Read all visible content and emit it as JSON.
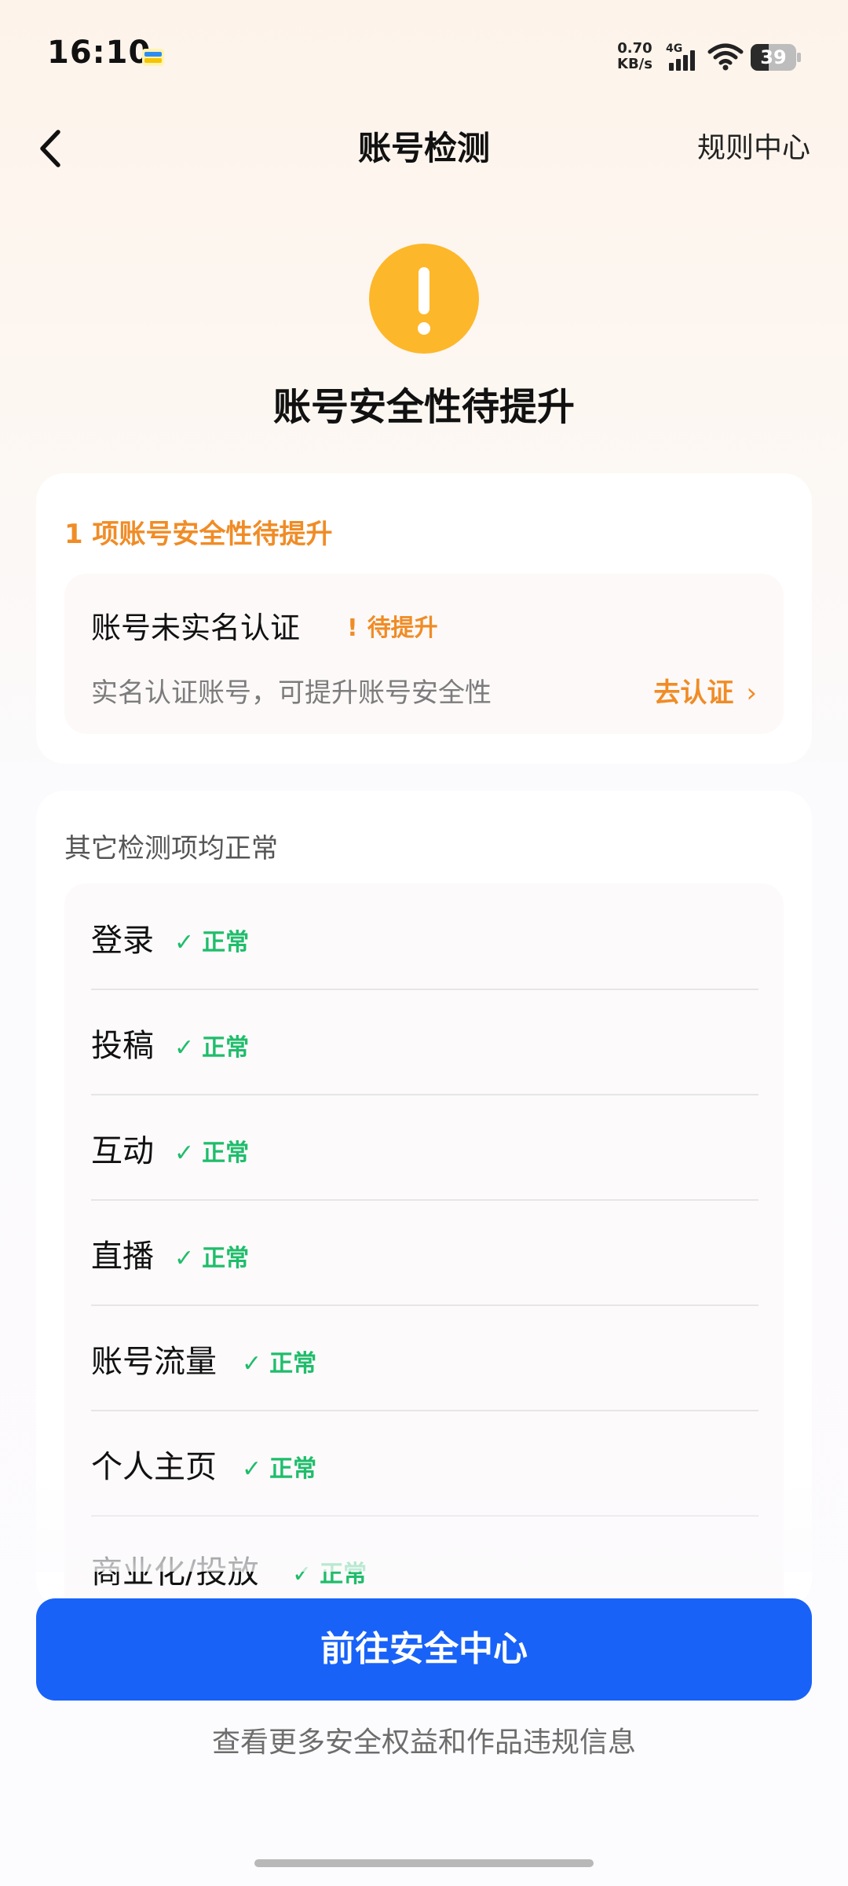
{
  "status_bar": {
    "time": "16:10",
    "net_speed_value": "0.70",
    "net_speed_unit": "KB/s",
    "network_type": "4G",
    "battery_level": "39",
    "battery_fraction": 0.39
  },
  "nav": {
    "title": "账号检测",
    "rules_label": "规则中心"
  },
  "status": {
    "title": "账号安全性待提升",
    "icon": "warning-icon",
    "color": "#fdb72a"
  },
  "issues": {
    "heading": "1 项账号安全性待提升",
    "items": [
      {
        "title": "账号未实名认证",
        "badge": "待提升",
        "description": "实名认证账号，可提升账号安全性",
        "action": "去认证"
      }
    ]
  },
  "checks": {
    "heading": "其它检测项均正常",
    "items": [
      {
        "label": "登录",
        "status": "正常"
      },
      {
        "label": "投稿",
        "status": "正常"
      },
      {
        "label": "互动",
        "status": "正常"
      },
      {
        "label": "直播",
        "status": "正常"
      },
      {
        "label": "账号流量",
        "status": "正常"
      },
      {
        "label": "个人主页",
        "status": "正常"
      },
      {
        "label": "商业化/投放",
        "status": "正常"
      }
    ]
  },
  "footer": {
    "button_label": "前往安全中心",
    "note": "查看更多安全权益和作品违规信息"
  },
  "colors": {
    "accent_orange": "#f08c26",
    "ok_green": "#1fbd6b",
    "primary_blue": "#1862f8"
  }
}
